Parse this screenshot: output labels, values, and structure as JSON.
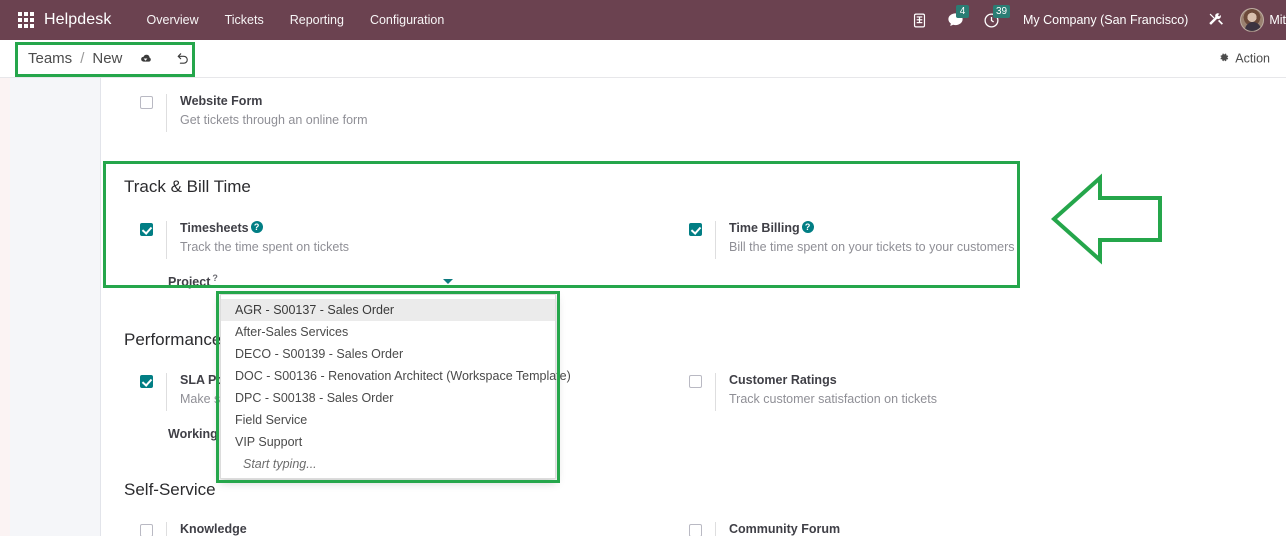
{
  "topbar": {
    "apps_icon": "apps-grid-icon",
    "brand": "Helpdesk",
    "menu": [
      {
        "label": "Overview"
      },
      {
        "label": "Tickets"
      },
      {
        "label": "Reporting"
      },
      {
        "label": "Configuration"
      }
    ],
    "sys_icons": [
      {
        "name": "voip-phone-icon",
        "badge": ""
      },
      {
        "name": "messages-icon",
        "badge": "4"
      },
      {
        "name": "activities-clock-icon",
        "badge": "39"
      }
    ],
    "messages_badge": "4",
    "activities_badge": "39",
    "company": "My Company (San Francisco)",
    "tools_icon": "tools-wrench-screwdriver-icon",
    "username": "Mit",
    "accent_bar": "#6b4250",
    "badge_color": "#2a7d74"
  },
  "controlpanel": {
    "breadcrumb_root": "Teams",
    "breadcrumb_sep": "/",
    "breadcrumb_current": "New",
    "save_icon": "cloud-save-icon",
    "discard_icon": "discard-undo-icon",
    "action_label": "Action",
    "action_icon": "gear-icon"
  },
  "settings": {
    "website_form": {
      "label": "Website Form",
      "desc": "Get tickets through an online form",
      "checked": false
    },
    "track_bill_time": {
      "title": "Track & Bill Time",
      "timesheets": {
        "label": "Timesheets",
        "desc": "Track the time spent on tickets",
        "checked": true,
        "help": "?"
      },
      "time_billing": {
        "label": "Time Billing",
        "desc": "Bill the time spent on your tickets to your customers",
        "checked": true,
        "help": "?"
      },
      "project": {
        "label": "Project",
        "required_marker": "?",
        "value": "",
        "placeholder": ""
      }
    },
    "performance": {
      "title": "Performance",
      "sla_policies": {
        "label": "SLA Policies",
        "desc_partial": "Make su",
        "checked": true
      },
      "working_hours_label": "Working",
      "customer_ratings": {
        "label": "Customer Ratings",
        "desc": "Track customer satisfaction on tickets",
        "checked": false
      }
    },
    "self_service": {
      "title": "Self-Service",
      "knowledge": {
        "label": "Knowledge",
        "checked": false
      },
      "community_forum": {
        "label": "Community Forum",
        "checked": false
      }
    }
  },
  "project_dropdown": {
    "open": true,
    "items": [
      {
        "label": "AGR - S00137 - Sales Order",
        "active": true
      },
      {
        "label": "After-Sales Services",
        "active": false
      },
      {
        "label": "DECO - S00139 - Sales Order",
        "active": false
      },
      {
        "label": "DOC - S00136 - Renovation Architect (Workspace Template)",
        "active": false
      },
      {
        "label": "DPC - S00138 - Sales Order",
        "active": false
      },
      {
        "label": "Field Service",
        "active": false
      },
      {
        "label": "VIP Support",
        "active": false
      }
    ],
    "hint": "Start typing..."
  },
  "annotations": {
    "color": "#25a64b",
    "boxes": [
      {
        "name": "breadcrumb-highlight"
      },
      {
        "name": "track-bill-time-highlight"
      },
      {
        "name": "project-dropdown-highlight"
      }
    ],
    "arrow": {
      "name": "left-pointing-arrow",
      "direction": "left"
    }
  }
}
